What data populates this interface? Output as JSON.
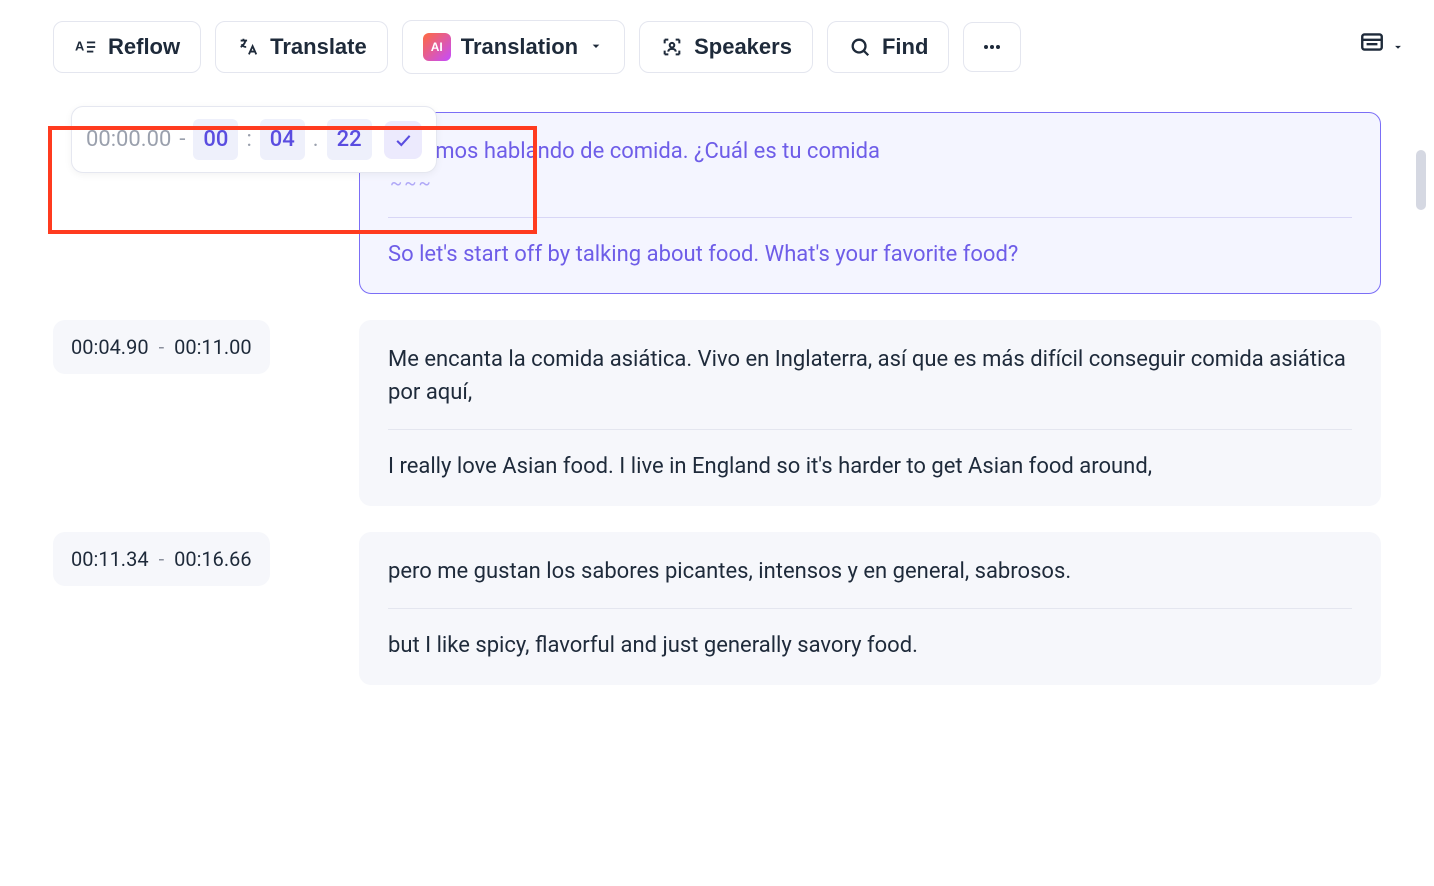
{
  "toolbar": {
    "reflow": "Reflow",
    "translate": "Translate",
    "translation": "Translation",
    "speakers": "Speakers",
    "find": "Find"
  },
  "editor": {
    "start": "00:00.00",
    "mm": "00",
    "ss": "04",
    "cs": "22"
  },
  "segments": [
    {
      "start": "00:00.00",
      "end": "00:04.22",
      "active": true,
      "src_prefix": "pecemos hablando de comida. ¿Cuál es tu comida",
      "src_suffix": "",
      "tgt": "So let's start off by talking about food. What's your favorite food?"
    },
    {
      "start": "00:04.90",
      "end": "00:11.00",
      "active": false,
      "src": "Me encanta la comida asiática. Vivo en Inglaterra, así que es más difícil conseguir comida asiática por aquí,",
      "tgt": "I really love Asian food. I live in England so it's harder to get Asian food around,"
    },
    {
      "start": "00:11.34",
      "end": "00:16.66",
      "active": false,
      "src": "pero me gustan los sabores picantes, intensos y en general, sabrosos.",
      "tgt": "but I like spicy, flavorful and just generally savory food."
    }
  ],
  "wave": "~~~"
}
